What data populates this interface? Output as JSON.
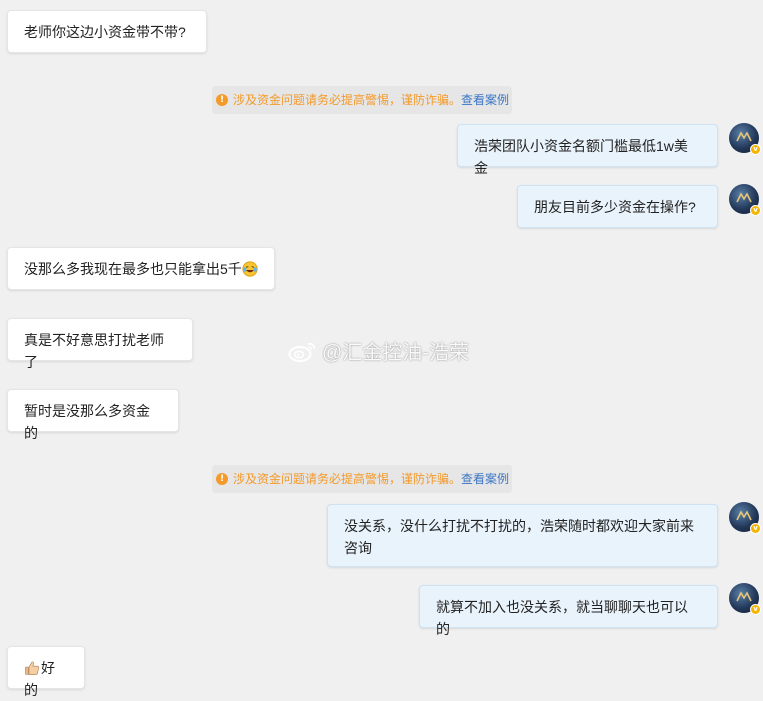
{
  "messages": [
    {
      "side": "left",
      "text": "老师你这边小资金带不带?"
    },
    {
      "side": "right",
      "text": "浩荣团队小资金名额门槛最低1w美金"
    },
    {
      "side": "right",
      "text": "朋友目前多少资金在操作?"
    },
    {
      "side": "left",
      "text": "没那么多我现在最多也只能拿出5千",
      "emoji": "laughing-tears"
    },
    {
      "side": "left",
      "text": "真是不好意思打扰老师了"
    },
    {
      "side": "left",
      "text": "暂时是没那么多资金的"
    },
    {
      "side": "right",
      "text": "没关系，没什么打扰不打扰的，浩荣随时都欢迎大家前来咨询"
    },
    {
      "side": "right",
      "text": "就算不加入也没关系，就当聊聊天也可以的"
    },
    {
      "side": "left",
      "text": "好的",
      "emoji": "thumbs-up"
    }
  ],
  "notice": {
    "text": "涉及资金问题请务必提高警惕，谨防诈骗。",
    "link": "查看案例",
    "icon": "exclamation",
    "icon_symbol": "!",
    "color": "#f39a2b",
    "link_color": "#3b76c4"
  },
  "avatar": {
    "icon": "profile-avatar",
    "badge": "vip-badge",
    "badge_symbol": "v"
  },
  "watermark": {
    "text": "@汇金控油-浩荣",
    "icon": "weibo-icon"
  }
}
